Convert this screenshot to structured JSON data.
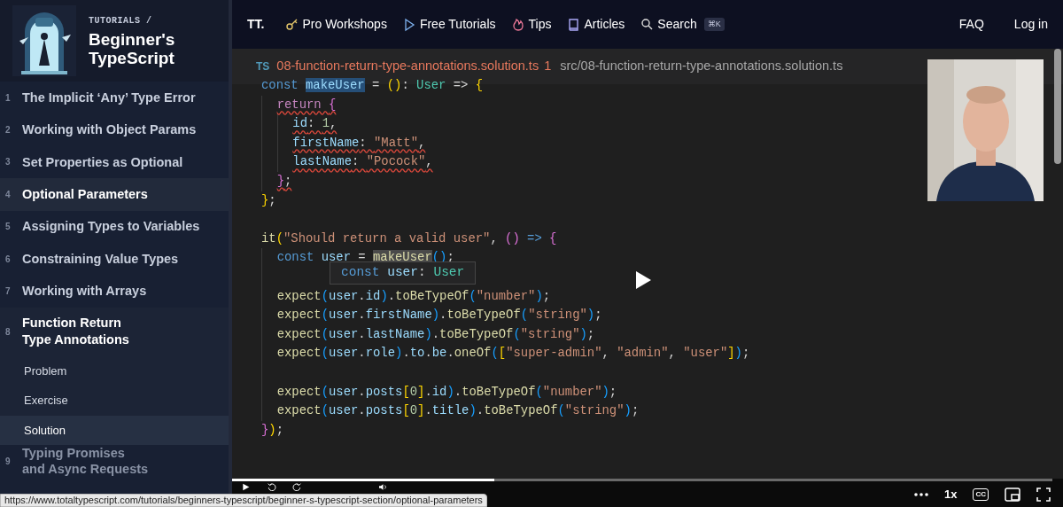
{
  "sidebar": {
    "breadcrumb": "TUTORIALS /",
    "title": "Beginner's TypeScript",
    "items": [
      {
        "number": "1",
        "title": "The Implicit ‘Any’ Type Error",
        "selected": false,
        "expanded": false
      },
      {
        "number": "2",
        "title": "Working with Object Params",
        "selected": false,
        "expanded": false
      },
      {
        "number": "3",
        "title": "Set Properties as Optional",
        "selected": false,
        "expanded": false
      },
      {
        "number": "4",
        "title": "Optional Parameters",
        "selected": true,
        "expanded": false
      },
      {
        "number": "5",
        "title": "Assigning Types to Variables",
        "selected": false,
        "expanded": false
      },
      {
        "number": "6",
        "title": "Constraining Value Types",
        "selected": false,
        "expanded": false
      },
      {
        "number": "7",
        "title": "Working with Arrays",
        "selected": false,
        "expanded": false
      },
      {
        "number": "8",
        "title": "Function Return\nType Annotations",
        "selected": false,
        "expanded": true,
        "children": [
          {
            "title": "Problem",
            "selected": false
          },
          {
            "title": "Exercise",
            "selected": false
          },
          {
            "title": "Solution",
            "selected": true
          }
        ]
      },
      {
        "number": "9",
        "title": "Typing Promises\nand Async Requests",
        "selected": false,
        "expanded": false
      }
    ]
  },
  "nav": {
    "logo": "TT.",
    "links": [
      {
        "kind": "key",
        "label": "Pro Workshops"
      },
      {
        "kind": "play",
        "label": "Free Tutorials"
      },
      {
        "kind": "flame",
        "label": "Tips"
      },
      {
        "kind": "book",
        "label": "Articles"
      },
      {
        "kind": "search",
        "label": "Search",
        "shortcut": "⌘K"
      }
    ],
    "right": [
      "FAQ",
      "Log in"
    ]
  },
  "editor": {
    "lang": "TS",
    "filename": "08-function-return-type-annotations.solution.ts",
    "problems": "1",
    "path": "src/08-function-return-type-annotations.solution.ts",
    "lines": [
      {
        "kind": "code",
        "error": false,
        "tokens": [
          {
            "kind": "keyword",
            "text": "const "
          },
          {
            "kind": "selection",
            "text": "makeUser"
          },
          {
            "kind": "plain",
            "text": " = "
          },
          {
            "kind": "bracket1",
            "text": "()"
          },
          {
            "kind": "plain",
            "text": ": "
          },
          {
            "kind": "type",
            "text": "User"
          },
          {
            "kind": "plain",
            "text": " => "
          },
          {
            "kind": "bracket1",
            "text": "{"
          }
        ],
        "children": [
          {
            "kind": "code",
            "error": true,
            "tokens": [
              {
                "kind": "control",
                "text": "return "
              },
              {
                "kind": "bracket2",
                "text": "{"
              }
            ],
            "children": [
              {
                "kind": "code",
                "error": true,
                "tokens": [
                  {
                    "kind": "variable",
                    "text": "id"
                  },
                  {
                    "kind": "plain",
                    "text": ": "
                  },
                  {
                    "kind": "number",
                    "text": "1"
                  },
                  {
                    "kind": "plain",
                    "text": ","
                  }
                ]
              },
              {
                "kind": "code",
                "error": true,
                "tokens": [
                  {
                    "kind": "variable",
                    "text": "firstName"
                  },
                  {
                    "kind": "plain",
                    "text": ": "
                  },
                  {
                    "kind": "string",
                    "text": "\"Matt\""
                  },
                  {
                    "kind": "plain",
                    "text": ","
                  }
                ]
              },
              {
                "kind": "code",
                "error": true,
                "tokens": [
                  {
                    "kind": "variable",
                    "text": "lastName"
                  },
                  {
                    "kind": "plain",
                    "text": ": "
                  },
                  {
                    "kind": "string",
                    "text": "\"Pocock\""
                  },
                  {
                    "kind": "plain",
                    "text": ","
                  }
                ]
              }
            ]
          },
          {
            "kind": "code",
            "error": true,
            "tokens": [
              {
                "kind": "bracket2",
                "text": "}"
              },
              {
                "kind": "plain",
                "text": ";"
              }
            ]
          }
        ]
      },
      {
        "kind": "code",
        "error": false,
        "tokens": [
          {
            "kind": "bracket1",
            "text": "}"
          },
          {
            "kind": "plain",
            "text": ";"
          }
        ]
      },
      {
        "kind": "blank"
      },
      {
        "kind": "code",
        "error": false,
        "tokens": [
          {
            "kind": "function",
            "text": "it"
          },
          {
            "kind": "bracket1",
            "text": "("
          },
          {
            "kind": "string",
            "text": "\"Should return a valid user\""
          },
          {
            "kind": "plain",
            "text": ", "
          },
          {
            "kind": "bracket2",
            "text": "()"
          },
          {
            "kind": "keyword",
            "text": " => "
          },
          {
            "kind": "bracket2",
            "text": "{"
          }
        ],
        "children": [
          {
            "kind": "code",
            "error": false,
            "tokens": [
              {
                "kind": "keyword",
                "text": "const "
              },
              {
                "kind": "variable",
                "text": "user"
              },
              {
                "kind": "plain",
                "text": " = "
              },
              {
                "kind": "reference",
                "text": "makeUser"
              },
              {
                "kind": "bracket3",
                "text": "()"
              },
              {
                "kind": "plain",
                "text": ";"
              }
            ]
          },
          {
            "kind": "blank"
          },
          {
            "kind": "code",
            "error": false,
            "tokens": [
              {
                "kind": "function",
                "text": "expect"
              },
              {
                "kind": "bracket3",
                "text": "("
              },
              {
                "kind": "variable",
                "text": "user"
              },
              {
                "kind": "plain",
                "text": "."
              },
              {
                "kind": "variable",
                "text": "id"
              },
              {
                "kind": "bracket3",
                "text": ")"
              },
              {
                "kind": "plain",
                "text": "."
              },
              {
                "kind": "function",
                "text": "toBeTypeOf"
              },
              {
                "kind": "bracket3",
                "text": "("
              },
              {
                "kind": "string",
                "text": "\"number\""
              },
              {
                "kind": "bracket3",
                "text": ")"
              },
              {
                "kind": "plain",
                "text": ";"
              }
            ]
          },
          {
            "kind": "code",
            "error": false,
            "tokens": [
              {
                "kind": "function",
                "text": "expect"
              },
              {
                "kind": "bracket3",
                "text": "("
              },
              {
                "kind": "variable",
                "text": "user"
              },
              {
                "kind": "plain",
                "text": "."
              },
              {
                "kind": "variable",
                "text": "firstName"
              },
              {
                "kind": "bracket3",
                "text": ")"
              },
              {
                "kind": "plain",
                "text": "."
              },
              {
                "kind": "function",
                "text": "toBeTypeOf"
              },
              {
                "kind": "bracket3",
                "text": "("
              },
              {
                "kind": "string",
                "text": "\"string\""
              },
              {
                "kind": "bracket3",
                "text": ")"
              },
              {
                "kind": "plain",
                "text": ";"
              }
            ]
          },
          {
            "kind": "code",
            "error": false,
            "tokens": [
              {
                "kind": "function",
                "text": "expect"
              },
              {
                "kind": "bracket3",
                "text": "("
              },
              {
                "kind": "variable",
                "text": "user"
              },
              {
                "kind": "plain",
                "text": "."
              },
              {
                "kind": "variable",
                "text": "lastName"
              },
              {
                "kind": "bracket3",
                "text": ")"
              },
              {
                "kind": "plain",
                "text": "."
              },
              {
                "kind": "function",
                "text": "toBeTypeOf"
              },
              {
                "kind": "bracket3",
                "text": "("
              },
              {
                "kind": "string",
                "text": "\"string\""
              },
              {
                "kind": "bracket3",
                "text": ")"
              },
              {
                "kind": "plain",
                "text": ";"
              }
            ]
          },
          {
            "kind": "code",
            "error": false,
            "tokens": [
              {
                "kind": "function",
                "text": "expect"
              },
              {
                "kind": "bracket3",
                "text": "("
              },
              {
                "kind": "variable",
                "text": "user"
              },
              {
                "kind": "plain",
                "text": "."
              },
              {
                "kind": "variable",
                "text": "role"
              },
              {
                "kind": "bracket3",
                "text": ")"
              },
              {
                "kind": "plain",
                "text": "."
              },
              {
                "kind": "variable",
                "text": "to"
              },
              {
                "kind": "plain",
                "text": "."
              },
              {
                "kind": "variable",
                "text": "be"
              },
              {
                "kind": "plain",
                "text": "."
              },
              {
                "kind": "function",
                "text": "oneOf"
              },
              {
                "kind": "bracket3",
                "text": "("
              },
              {
                "kind": "bracket1",
                "text": "["
              },
              {
                "kind": "string",
                "text": "\"super-admin\""
              },
              {
                "kind": "plain",
                "text": ", "
              },
              {
                "kind": "string",
                "text": "\"admin\""
              },
              {
                "kind": "plain",
                "text": ", "
              },
              {
                "kind": "string",
                "text": "\"user\""
              },
              {
                "kind": "bracket1",
                "text": "]"
              },
              {
                "kind": "bracket3",
                "text": ")"
              },
              {
                "kind": "plain",
                "text": ";"
              }
            ]
          },
          {
            "kind": "blank"
          },
          {
            "kind": "code",
            "error": false,
            "tokens": [
              {
                "kind": "function",
                "text": "expect"
              },
              {
                "kind": "bracket3",
                "text": "("
              },
              {
                "kind": "variable",
                "text": "user"
              },
              {
                "kind": "plain",
                "text": "."
              },
              {
                "kind": "variable",
                "text": "posts"
              },
              {
                "kind": "bracket1",
                "text": "["
              },
              {
                "kind": "number",
                "text": "0"
              },
              {
                "kind": "bracket1",
                "text": "]"
              },
              {
                "kind": "plain",
                "text": "."
              },
              {
                "kind": "variable",
                "text": "id"
              },
              {
                "kind": "bracket3",
                "text": ")"
              },
              {
                "kind": "plain",
                "text": "."
              },
              {
                "kind": "function",
                "text": "toBeTypeOf"
              },
              {
                "kind": "bracket3",
                "text": "("
              },
              {
                "kind": "string",
                "text": "\"number\""
              },
              {
                "kind": "bracket3",
                "text": ")"
              },
              {
                "kind": "plain",
                "text": ";"
              }
            ]
          },
          {
            "kind": "code",
            "error": false,
            "tokens": [
              {
                "kind": "function",
                "text": "expect"
              },
              {
                "kind": "bracket3",
                "text": "("
              },
              {
                "kind": "variable",
                "text": "user"
              },
              {
                "kind": "plain",
                "text": "."
              },
              {
                "kind": "variable",
                "text": "posts"
              },
              {
                "kind": "bracket1",
                "text": "["
              },
              {
                "kind": "number",
                "text": "0"
              },
              {
                "kind": "bracket1",
                "text": "]"
              },
              {
                "kind": "plain",
                "text": "."
              },
              {
                "kind": "variable",
                "text": "title"
              },
              {
                "kind": "bracket3",
                "text": ")"
              },
              {
                "kind": "plain",
                "text": "."
              },
              {
                "kind": "function",
                "text": "toBeTypeOf"
              },
              {
                "kind": "bracket3",
                "text": "("
              },
              {
                "kind": "string",
                "text": "\"string\""
              },
              {
                "kind": "bracket3",
                "text": ")"
              },
              {
                "kind": "plain",
                "text": ";"
              }
            ]
          }
        ]
      },
      {
        "kind": "code",
        "error": false,
        "tokens": [
          {
            "kind": "bracket2",
            "text": "}"
          },
          {
            "kind": "bracket1",
            "text": ")"
          },
          {
            "kind": "plain",
            "text": ";"
          }
        ]
      }
    ],
    "tooltip": [
      {
        "kind": "keyword",
        "text": "const "
      },
      {
        "kind": "variable",
        "text": "user"
      },
      {
        "kind": "plain",
        "text": ": "
      },
      {
        "kind": "type",
        "text": "User"
      }
    ]
  },
  "player": {
    "level": 0.32,
    "speed": "1x",
    "captions": "CC"
  },
  "status_url": "https://www.totaltypescript.com/tutorials/beginners-typescript/beginner-s-typescript-section/optional-parameters"
}
